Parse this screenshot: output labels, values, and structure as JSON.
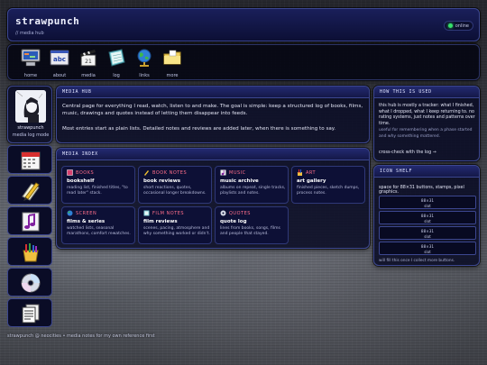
{
  "header": {
    "title": "strawpunch",
    "subtitle": "// media hub",
    "status": "online",
    "status_color": "#35e06a"
  },
  "nav": {
    "items": [
      {
        "label": "home",
        "icon": "computer-icon"
      },
      {
        "label": "about",
        "icon": "abc-icon"
      },
      {
        "label": "media",
        "icon": "clapperboard-icon"
      },
      {
        "label": "log",
        "icon": "notebook-icon"
      },
      {
        "label": "links",
        "icon": "globe-icon"
      },
      {
        "label": "more",
        "icon": "folder-icon"
      }
    ],
    "about_icon_text": "abc",
    "media_icon_text": "21"
  },
  "sidebar": {
    "profile_name": "strawpunch",
    "profile_mode": "media log mode",
    "buttons": [
      {
        "icon": "calendar-icon"
      },
      {
        "icon": "pencil-icon"
      },
      {
        "icon": "music-note-icon"
      },
      {
        "icon": "paint-icon"
      },
      {
        "icon": "cd-icon"
      },
      {
        "icon": "document-icon"
      }
    ]
  },
  "hub": {
    "heading": "MEDIA HUB",
    "p1": "Central page for everything I read, watch, listen to and make. The goal is simple: keep a structured log of books, films, music, drawings and quotes instead of letting them disappear into feeds.",
    "p2": "Most entries start as plain lists. Detailed notes and reviews are added later, when there is something to say."
  },
  "index": {
    "heading": "MEDIA INDEX",
    "cards": [
      {
        "tag": "BOOKS",
        "title": "bookshelf",
        "desc": "reading list, finished titles, \"to read later\" stack.",
        "color": "#ff6e8a"
      },
      {
        "tag": "BOOK NOTES",
        "title": "book reviews",
        "desc": "short reactions, quotes, occasional longer breakdowns.",
        "color": "#ff6e8a"
      },
      {
        "tag": "MUSIC",
        "title": "music archive",
        "desc": "albums on repeat, single tracks, playlists and notes.",
        "color": "#ff6e8a"
      },
      {
        "tag": "ART",
        "title": "art gallery",
        "desc": "finished pieces, sketch dumps, process notes.",
        "color": "#ff6e8a"
      },
      {
        "tag": "SCREEN",
        "title": "films & series",
        "desc": "watched lists, seasonal marathons, comfort rewatches.",
        "color": "#ff6e8a"
      },
      {
        "tag": "FILM NOTES",
        "title": "film reviews",
        "desc": "scenes, pacing, atmosphere and why something worked or didn't.",
        "color": "#ff6e8a"
      },
      {
        "tag": "QUOTES",
        "title": "quote log",
        "desc": "lines from books, songs, films and people that stayed.",
        "color": "#ff6e8a"
      }
    ]
  },
  "how": {
    "heading": "HOW THIS IS USED",
    "p1": "this hub is mostly a tracker: what I finished, what I dropped, what I keep returning to. no rating systems, just notes and patterns over time.",
    "p2": "useful for remembering when a phase started and why something mattered.",
    "link": "cross-check with the log →"
  },
  "shelf": {
    "heading": "ICON SHELF",
    "intro": "space for 88×31 buttons, stamps, pixel graphics.",
    "slots": [
      {
        "size": "88×31",
        "label": "slot"
      },
      {
        "size": "88×31",
        "label": "slot"
      },
      {
        "size": "88×31",
        "label": "slot"
      },
      {
        "size": "88×31",
        "label": "slot"
      }
    ],
    "footer": "will fill this once I collect more buttons."
  },
  "footer": "strawpunch @ neocities • media notes for my own reference first"
}
